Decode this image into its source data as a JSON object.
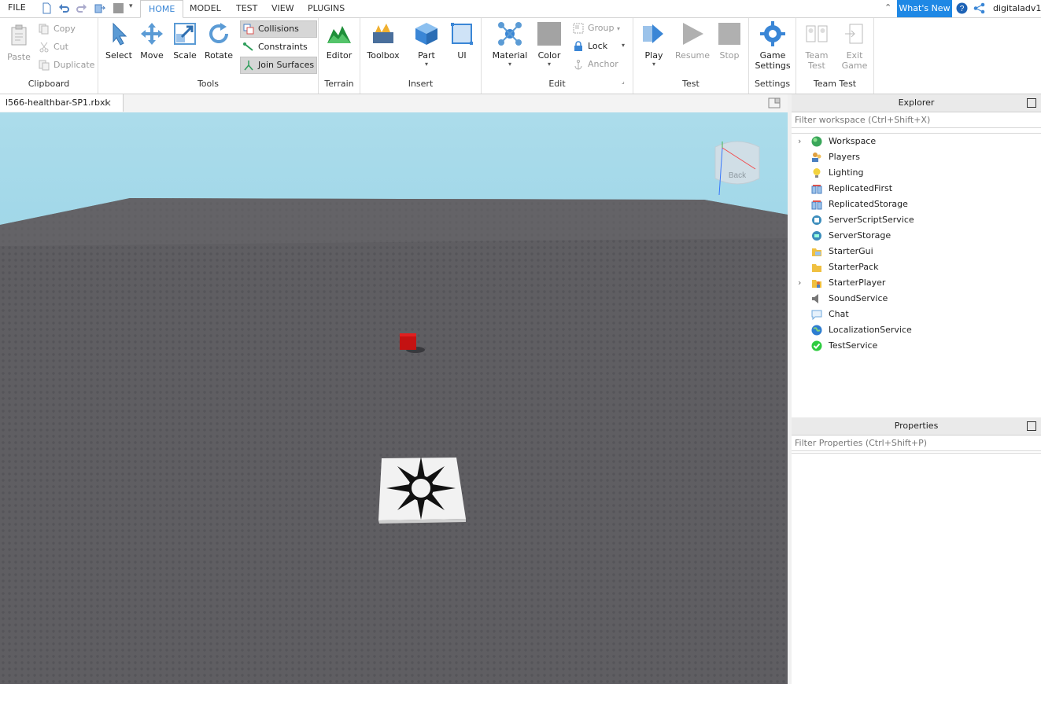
{
  "topbar": {
    "file_label": "FILE",
    "tabs": [
      {
        "label": "HOME",
        "active": true
      },
      {
        "label": "MODEL"
      },
      {
        "label": "TEST"
      },
      {
        "label": "VIEW"
      },
      {
        "label": "PLUGINS"
      }
    ],
    "whats_new": "What's New",
    "username": "digitaladv1"
  },
  "ribbon": {
    "clipboard": {
      "label": "Clipboard",
      "paste": "Paste",
      "copy": "Copy",
      "cut": "Cut",
      "duplicate": "Duplicate"
    },
    "tools": {
      "label": "Tools",
      "select": "Select",
      "move": "Move",
      "scale": "Scale",
      "rotate": "Rotate",
      "collisions": "Collisions",
      "constraints": "Constraints",
      "join_surfaces": "Join Surfaces"
    },
    "terrain": {
      "label": "Terrain",
      "editor": "Editor"
    },
    "insert": {
      "label": "Insert",
      "toolbox": "Toolbox",
      "part": "Part",
      "ui": "UI"
    },
    "edit": {
      "label": "Edit",
      "material": "Material",
      "color": "Color",
      "group": "Group",
      "lock": "Lock",
      "anchor": "Anchor"
    },
    "test": {
      "label": "Test",
      "play": "Play",
      "resume": "Resume",
      "stop": "Stop"
    },
    "settings": {
      "label": "Settings",
      "game_settings_1": "Game",
      "game_settings_2": "Settings"
    },
    "teamtest": {
      "label": "Team Test",
      "team_test_1": "Team",
      "team_test_2": "Test",
      "exit_game_1": "Exit",
      "exit_game_2": "Game"
    }
  },
  "document": {
    "tab_title": "l566-healthbar-SP1.rbxl"
  },
  "viewport": {
    "back_label": "Back"
  },
  "explorer": {
    "title": "Explorer",
    "filter_placeholder": "Filter workspace (Ctrl+Shift+X)",
    "items": [
      {
        "label": "Workspace",
        "expandable": true,
        "icon": "workspace-icon",
        "color": "#3aa65a"
      },
      {
        "label": "Players",
        "expandable": false,
        "icon": "players-icon",
        "color": "#e0a040"
      },
      {
        "label": "Lighting",
        "expandable": false,
        "icon": "lighting-icon",
        "color": "#f2c12e"
      },
      {
        "label": "ReplicatedFirst",
        "expandable": false,
        "icon": "replicated-first-icon",
        "color": "#d9534f"
      },
      {
        "label": "ReplicatedStorage",
        "expandable": false,
        "icon": "replicated-storage-icon",
        "color": "#d9534f"
      },
      {
        "label": "ServerScriptService",
        "expandable": false,
        "icon": "server-script-service-icon",
        "color": "#3c8dbc"
      },
      {
        "label": "ServerStorage",
        "expandable": false,
        "icon": "server-storage-icon",
        "color": "#3c8dbc"
      },
      {
        "label": "StarterGui",
        "expandable": false,
        "icon": "starter-gui-icon",
        "color": "#f0c040"
      },
      {
        "label": "StarterPack",
        "expandable": false,
        "icon": "starter-pack-icon",
        "color": "#f0c040"
      },
      {
        "label": "StarterPlayer",
        "expandable": true,
        "icon": "starter-player-icon",
        "color": "#f0a030"
      },
      {
        "label": "SoundService",
        "expandable": false,
        "icon": "sound-service-icon",
        "color": "#777777"
      },
      {
        "label": "Chat",
        "expandable": false,
        "icon": "chat-icon",
        "color": "#6fa8dc"
      },
      {
        "label": "LocalizationService",
        "expandable": false,
        "icon": "localization-service-icon",
        "color": "#2e7dd1"
      },
      {
        "label": "TestService",
        "expandable": false,
        "icon": "test-service-icon",
        "color": "#2ecc40"
      }
    ]
  },
  "properties": {
    "title": "Properties",
    "filter_placeholder": "Filter Properties (Ctrl+Shift+P)"
  },
  "colors": {
    "accent": "#1e88e5",
    "sky": "#8fd0e6",
    "baseplate": "#5f5e62",
    "red_part": "#cc1111"
  }
}
